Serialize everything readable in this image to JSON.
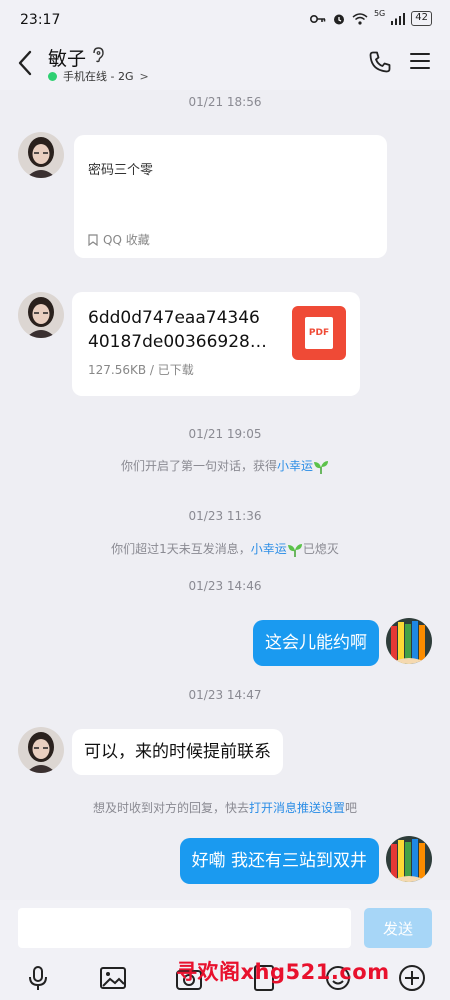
{
  "status_bar": {
    "time": "23:17",
    "network": "5G",
    "battery": "42"
  },
  "header": {
    "contact_name": "敏子",
    "presence": "手机在线 - 2G",
    "presence_chevron": ">"
  },
  "messages": {
    "ts1": "01/21 18:56",
    "favorite_card": {
      "text": "密码三个零",
      "source": "QQ 收藏"
    },
    "file_card": {
      "name_line1": "6dd0d747eaa74346",
      "name_line2": "40187de00366928…",
      "meta": "127.56KB / 已下载",
      "icon_label": "PDF"
    },
    "ts2": "01/21 19:05",
    "sys1": {
      "prefix": "你们开启了第一句对话，获得",
      "link": "小幸运",
      "suffix": ""
    },
    "ts3": "01/23 11:36",
    "sys2": {
      "prefix": "你们超过1天未互发消息，",
      "link": "小幸运",
      "suffix": "已熄灭"
    },
    "ts4": "01/23 14:46",
    "out1": "这会儿能约啊",
    "ts5": "01/23 14:47",
    "in1": "可以，来的时候提前联系",
    "sys3": {
      "prefix": "想及时收到对方的回复，快去",
      "link": "打开消息推送设置",
      "suffix": "吧"
    },
    "out2": "好嘞 我还有三站到双井"
  },
  "input": {
    "placeholder": "",
    "send_label": "发送"
  },
  "watermark": "寻欢阁xhg521.com",
  "colors": {
    "accent": "#1a9af0",
    "online": "#2fd072",
    "pdf": "#ef4a36",
    "watermark": "#e8112d"
  }
}
